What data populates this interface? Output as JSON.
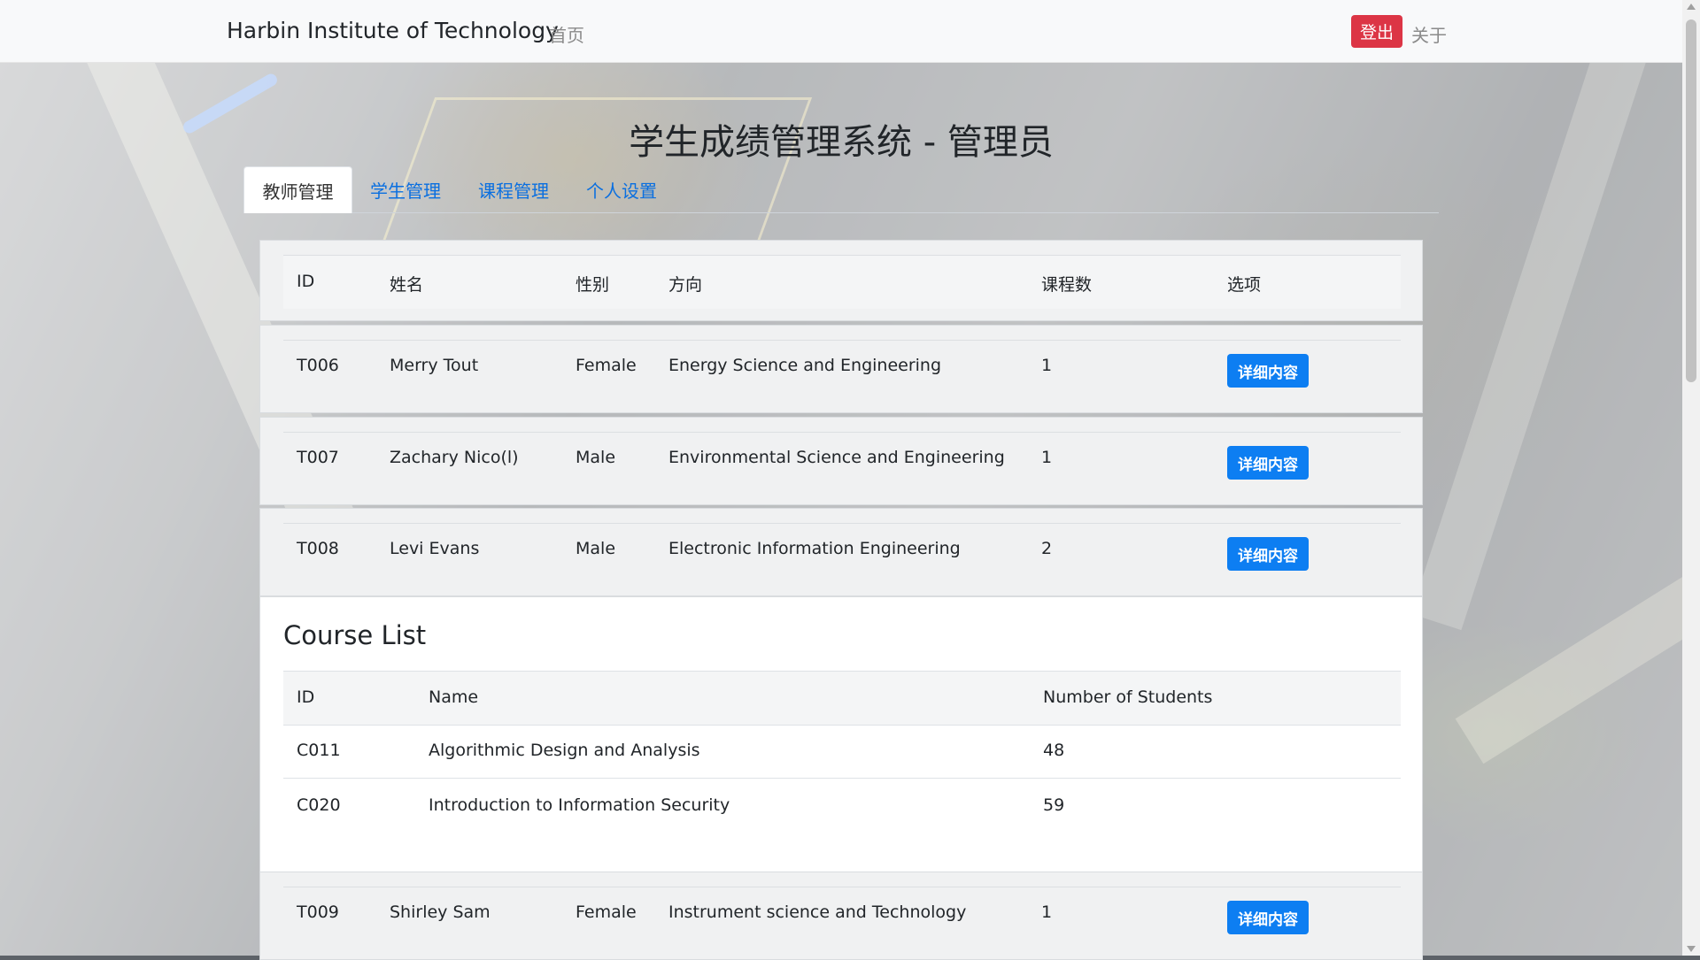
{
  "navbar": {
    "brand": "Harbin Institute of Technology",
    "home": "首页",
    "logout": "登出",
    "about": "关于",
    "logout_color": "#dc3545"
  },
  "page": {
    "title": "学生成绩管理系统 - 管理员"
  },
  "tabs": [
    {
      "label": "教师管理",
      "active": true
    },
    {
      "label": "学生管理",
      "active": false
    },
    {
      "label": "课程管理",
      "active": false
    },
    {
      "label": "个人设置",
      "active": false
    }
  ],
  "teacher_table": {
    "headers": [
      "ID",
      "姓名",
      "性别",
      "方向",
      "课程数",
      "选项"
    ],
    "detail_label": "详细内容",
    "rows": [
      {
        "id": "T006",
        "name": "Merry Tout",
        "gender": "Female",
        "direction": "Energy Science and Engineering",
        "courses": "1"
      },
      {
        "id": "T007",
        "name": "Zachary Nico(l)",
        "gender": "Male",
        "direction": "Environmental Science and Engineering",
        "courses": "1"
      },
      {
        "id": "T008",
        "name": "Levi Evans",
        "gender": "Male",
        "direction": "Electronic Information Engineering",
        "courses": "2"
      },
      {
        "id": "T009",
        "name": "Shirley Sam",
        "gender": "Female",
        "direction": "Instrument science and Technology",
        "courses": "1"
      }
    ]
  },
  "course_list": {
    "title": "Course List",
    "headers": [
      "ID",
      "Name",
      "Number of Students"
    ],
    "rows": [
      {
        "id": "C011",
        "name": "Algorithmic Design and Analysis",
        "students": "48"
      },
      {
        "id": "C020",
        "name": "Introduction to Information Security",
        "students": "59"
      }
    ]
  },
  "colors": {
    "accent": "#0d7ef2",
    "danger": "#dc3545"
  }
}
